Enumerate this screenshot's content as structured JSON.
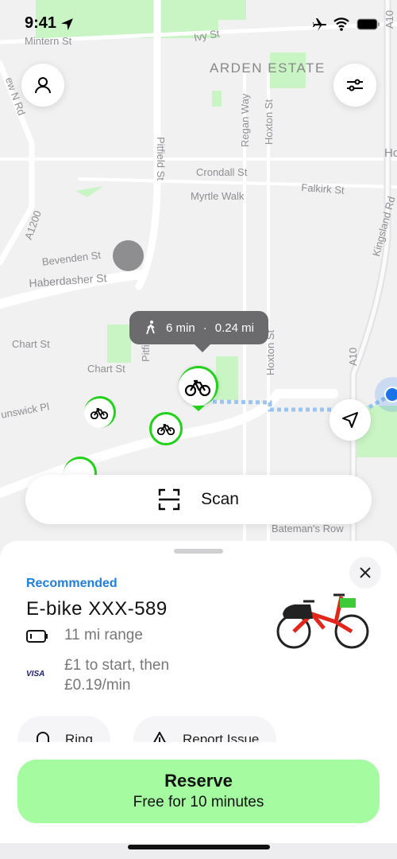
{
  "status_bar": {
    "time": "9:41",
    "icons": [
      "location-arrow-icon",
      "airplane-icon",
      "wifi-icon",
      "battery-icon"
    ]
  },
  "map": {
    "labels": {
      "mintern": "Mintern St",
      "ivy": "Ivy St",
      "arden": "ARDEN ESTATE",
      "regan": "Regan Way",
      "hoxton1": "Hoxton St",
      "pitfield": "Pitfield St",
      "crondall": "Crondall St",
      "myrtle": "Myrtle Walk",
      "falkirk": "Falkirk St",
      "kingsland": "Kingsland Rd",
      "a10a": "A10",
      "a10b": "A10",
      "a1200": "A1200",
      "newnrd": "ew N Rd",
      "bevenden": "Bevenden St",
      "haberdasher": "Haberdasher St",
      "chart1": "Chart St",
      "chart2": "Chart St",
      "pitfield2": "Pitfi",
      "hoxton2": "Hoxton St",
      "brunswick": "unswick Pl",
      "bateman": "Bateman's Row",
      "ho": "Ho"
    },
    "tooltip": {
      "walk_time": "6 min",
      "separator": "·",
      "distance": "0.24 mi"
    },
    "colors": {
      "park": "#c9f5c4",
      "route": "#9cc4f0",
      "marker_ring": "#22d11a",
      "user": "#1a73e8"
    }
  },
  "scan_button": {
    "label": "Scan"
  },
  "sheet": {
    "badge": "Recommended",
    "title": "E-bike XXX-589",
    "range": "11 mi range",
    "card_brand": "VISA",
    "price_line1": "£1 to start, then",
    "price_line2": "£0.19/min",
    "actions": [
      {
        "label": "Ring"
      },
      {
        "label": "Report Issue"
      }
    ],
    "reserve": {
      "label": "Reserve",
      "sublabel": "Free for 10 minutes"
    },
    "accent": "#1d7fe0",
    "reserve_color": "#a5fba0"
  }
}
